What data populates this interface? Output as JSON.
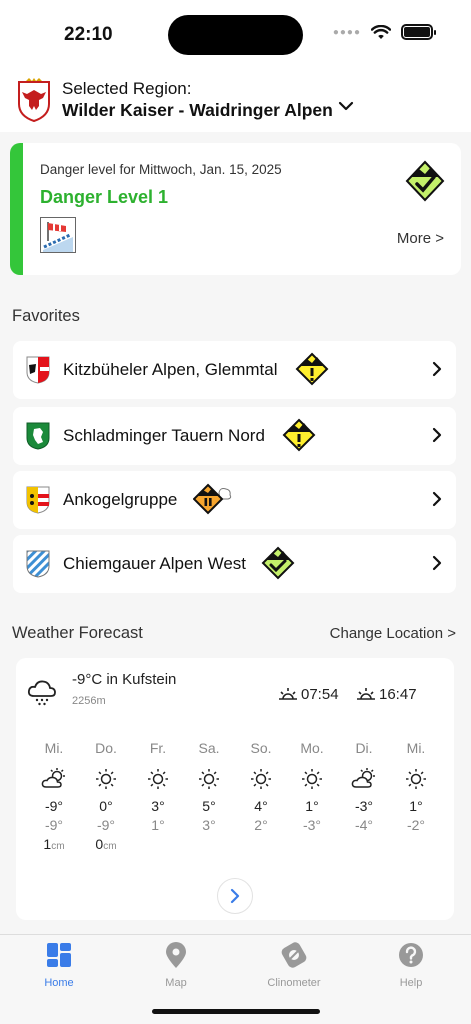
{
  "status": {
    "time": "22:10"
  },
  "region": {
    "label": "Selected Region:",
    "name": "Wilder Kaiser - Waidringer Alpen"
  },
  "danger": {
    "date_text": "Danger level for Mittwoch, Jan. 15, 2025",
    "level_text": "Danger Level 1",
    "more_label": "More >",
    "color": "#2db12f"
  },
  "favorites_title": "Favorites",
  "favorites": [
    {
      "name": "Kitzbüheler Alpen, Glemmtal",
      "danger": "level-2"
    },
    {
      "name": "Schladminger Tauern Nord",
      "danger": "level-2"
    },
    {
      "name": "Ankogelgruppe",
      "danger": "level-3"
    },
    {
      "name": "Chiemgauer Alpen West",
      "danger": "level-1"
    }
  ],
  "weather": {
    "title": "Weather Forecast",
    "change_label": "Change Location >",
    "location": "-9°C in Kufstein",
    "elevation": "2256m",
    "sunrise": "07:54",
    "sunset": "16:47",
    "days": [
      {
        "name": "Mi.",
        "icon": "partly-cloudy-icon",
        "hi": "-9°",
        "lo": "-9°",
        "snow": "1",
        "unit": "cm"
      },
      {
        "name": "Do.",
        "icon": "sun-icon",
        "hi": "0°",
        "lo": "-9°",
        "snow": "0",
        "unit": "cm"
      },
      {
        "name": "Fr.",
        "icon": "sun-icon",
        "hi": "3°",
        "lo": "1°",
        "snow": "",
        "unit": ""
      },
      {
        "name": "Sa.",
        "icon": "sun-icon",
        "hi": "5°",
        "lo": "3°",
        "snow": "",
        "unit": ""
      },
      {
        "name": "So.",
        "icon": "sun-icon",
        "hi": "4°",
        "lo": "2°",
        "snow": "",
        "unit": ""
      },
      {
        "name": "Mo.",
        "icon": "sun-icon",
        "hi": "1°",
        "lo": "-3°",
        "snow": "",
        "unit": ""
      },
      {
        "name": "Di.",
        "icon": "partly-cloudy-icon",
        "hi": "-3°",
        "lo": "-4°",
        "snow": "",
        "unit": ""
      },
      {
        "name": "Mi.",
        "icon": "sun-icon",
        "hi": "1°",
        "lo": "-2°",
        "snow": "",
        "unit": ""
      }
    ]
  },
  "tabs": [
    {
      "label": "Home",
      "active": true
    },
    {
      "label": "Map",
      "active": false
    },
    {
      "label": "Clinometer",
      "active": false
    },
    {
      "label": "Help",
      "active": false
    }
  ],
  "colors": {
    "accent": "#3a7ce8",
    "level1": "#c4f06a",
    "level2": "#ffef2e",
    "level3": "#f6a52e"
  }
}
